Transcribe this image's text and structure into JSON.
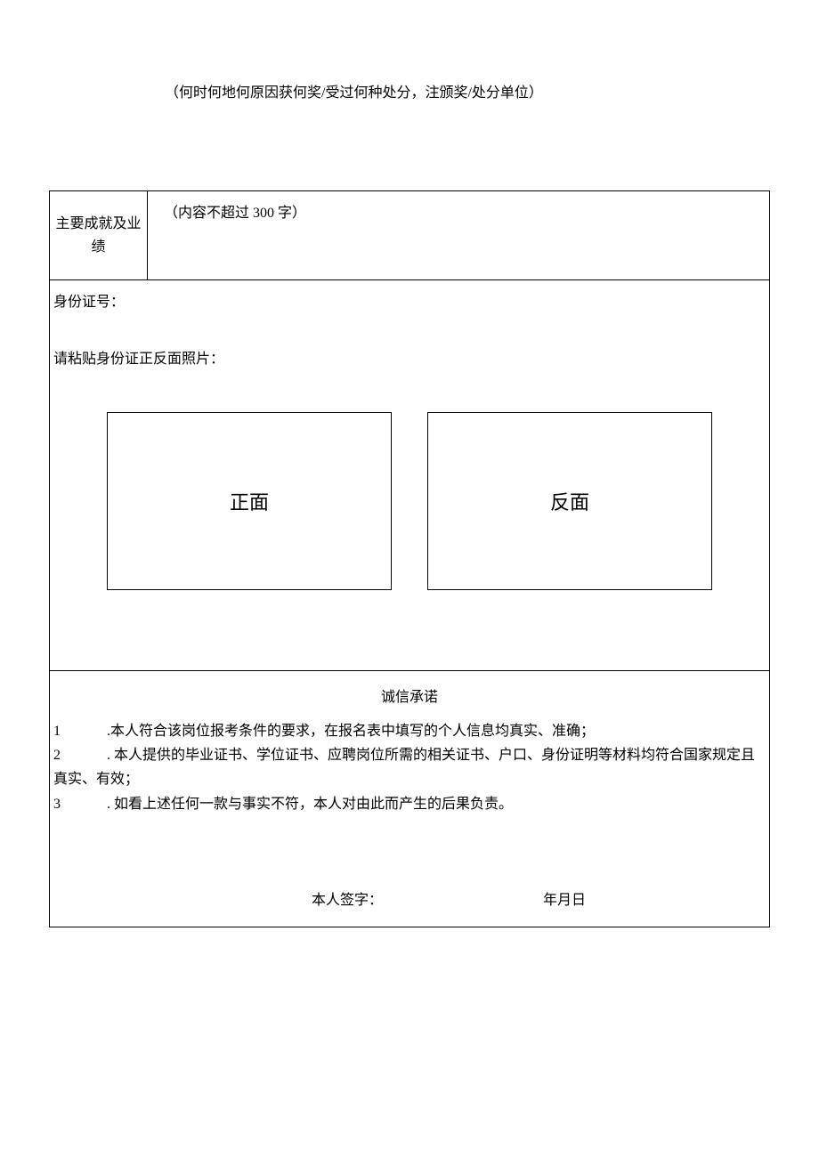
{
  "topNote": "（何时何地何原因获何奖/受过何种处分，注颁奖/处分单位）",
  "row1": {
    "label": "主要成就及业绩",
    "hint": "（内容不超过 300 字）"
  },
  "row2": {
    "idLabel": "身份证号：",
    "pasteLabel": "请粘贴身份证正反面照片：",
    "frontLabel": "正面",
    "backLabel": "反面"
  },
  "row3": {
    "title": "诚信承诺",
    "items": [
      {
        "num": "1",
        "text": ".本人符合该岗位报考条件的要求，在报名表中填写的个人信息均真实、准确；"
      },
      {
        "num": "2",
        "text": ". 本人提供的毕业证书、学位证书、应聘岗位所需的相关证书、户口、身份证明等材料均符合国家规定且真实、有效；"
      },
      {
        "num": "3",
        "text": ". 如看上述任何一款与事实不符，本人对由此而产生的后果负责。"
      }
    ],
    "signatureLabel": "本人签字：",
    "dateLabel": "年月日"
  }
}
